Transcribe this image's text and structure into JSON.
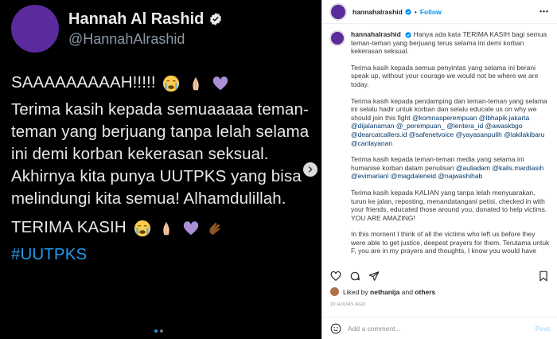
{
  "tweet": {
    "name": "Hannah Al Rashid",
    "handle": "@HannahAlrashid",
    "line1": "SAAAAAAAAAH!!!!!",
    "para1": "Terima kasih kepada semuaaaaa teman-teman yang berjuang tanpa lelah selama ini demi korban kekerasan seksual. Akhirnya kita punya UUTPKS yang bisa melindungi kita semua! Alhamdulillah.",
    "thanks": "TERIMA KASIH",
    "hashtag": "#UUTPKS",
    "colors": {
      "hashtag": "#1d9bf0",
      "verified": "#1d9bf0",
      "avatar": "#5b2a9c"
    }
  },
  "instagram": {
    "username": "hannahalrashid",
    "separator": "•",
    "follow_label": "Follow",
    "more_label": "•••",
    "caption": {
      "p1": "Hanya ada kata TERIMA KASIH bagi semua teman-teman yang berjuang terus selama ini demi korban kekerasan seksual.",
      "p2": "Terima kasih kepada semua penyintas yang selama ini berani speak up, without your courage we would not be where we are today.",
      "p3_text": "Terima kasih kepada pendamping dan teman-teman yang selama ini selalu hadir untuk korban dan selalu educate us on why we should join this fight",
      "p3_mentions": "@komnasperempuan @lbhapik.jakarta @dijalanaman @_perempuan_ @lentera_id @awaskbgo @dearcatcallers.id @safenetvoice @yayasanpulih @lakilakibaru @carilayanan",
      "p4_text": "Terima kasih kepada teman-teman media yang selama ini humanise korban dalam penulisan",
      "p4_mentions": "@auliadam @kalis.mardiasih @evimariani @magdaleneid @najwashihab",
      "p5": "Terima kasih kepada KALIAN yang tanpa lelah menyuarakan, turun ke jalan, reposting, menandatangani petisi, checked in with your friends, educated those around you, donated to help victims. YOU ARE AMAZING!",
      "p6": "In this moment I think of all the victims who left us before they were able to get justice, deepest prayers for them. Terutama untuk F, you are in my prayers and thoughts, I know you would have"
    },
    "likes": {
      "prefix": "Liked by",
      "user": "nethanija",
      "conjunction": "and",
      "others": "others"
    },
    "timestamp": "20 HOURS AGO",
    "comment_placeholder": "Add a comment...",
    "post_label": "Post",
    "icons": [
      "heart-icon",
      "comment-icon",
      "share-icon",
      "bookmark-icon",
      "emoji-icon"
    ],
    "colors": {
      "follow": "#0095f6",
      "mention": "#00376b",
      "post": "#b2dffc"
    }
  }
}
